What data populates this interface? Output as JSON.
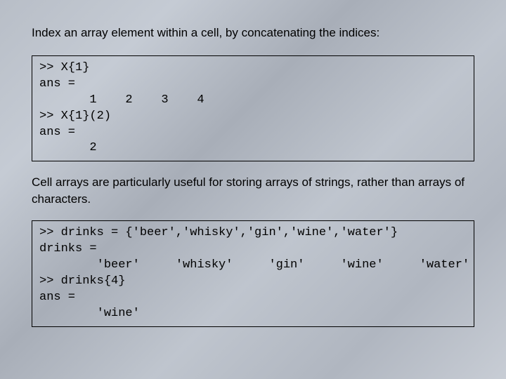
{
  "intro": "Index an array element within a cell, by concatenating the indices:",
  "code1": ">> X{1}\nans =\n       1    2    3    4\n>> X{1}(2)\nans =\n       2",
  "desc": "Cell arrays are particularly useful for storing arrays of strings, rather than arrays of characters.",
  "code2": ">> drinks = {'beer','whisky','gin','wine','water'}\ndrinks =\n        'beer'     'whisky'     'gin'     'wine'     'water'\n>> drinks{4}\nans =\n        'wine'"
}
